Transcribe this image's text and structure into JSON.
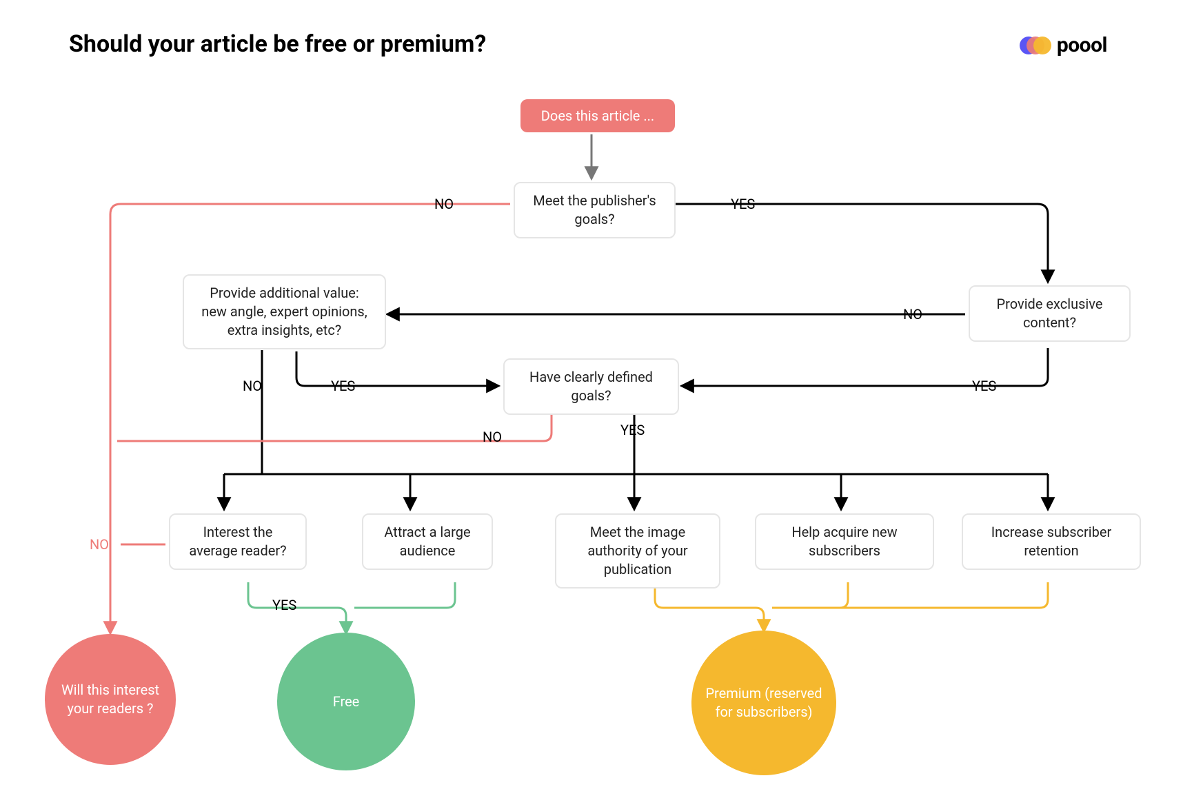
{
  "title": "Should your article be free or premium?",
  "brand": "poool",
  "nodes": {
    "start": "Does this article ...",
    "meet_goals": "Meet the publisher's goals?",
    "additional_value": "Provide additional value: new angle, expert opinions, extra insights, etc?",
    "exclusive": "Provide exclusive content?",
    "defined_goals": "Have clearly defined goals?",
    "interest_reader": "Interest the average reader?",
    "large_audience": "Attract a large audience",
    "image_authority": "Meet the image authority of your publication",
    "acquire_subs": "Help acquire new subscribers",
    "retention": "Increase subscriber retention"
  },
  "outcomes": {
    "interest_readers": "Will this interest your readers ?",
    "free": "Free",
    "premium": "Premium (reserved for subscribers)"
  },
  "labels": {
    "yes": "YES",
    "no": "NO"
  }
}
